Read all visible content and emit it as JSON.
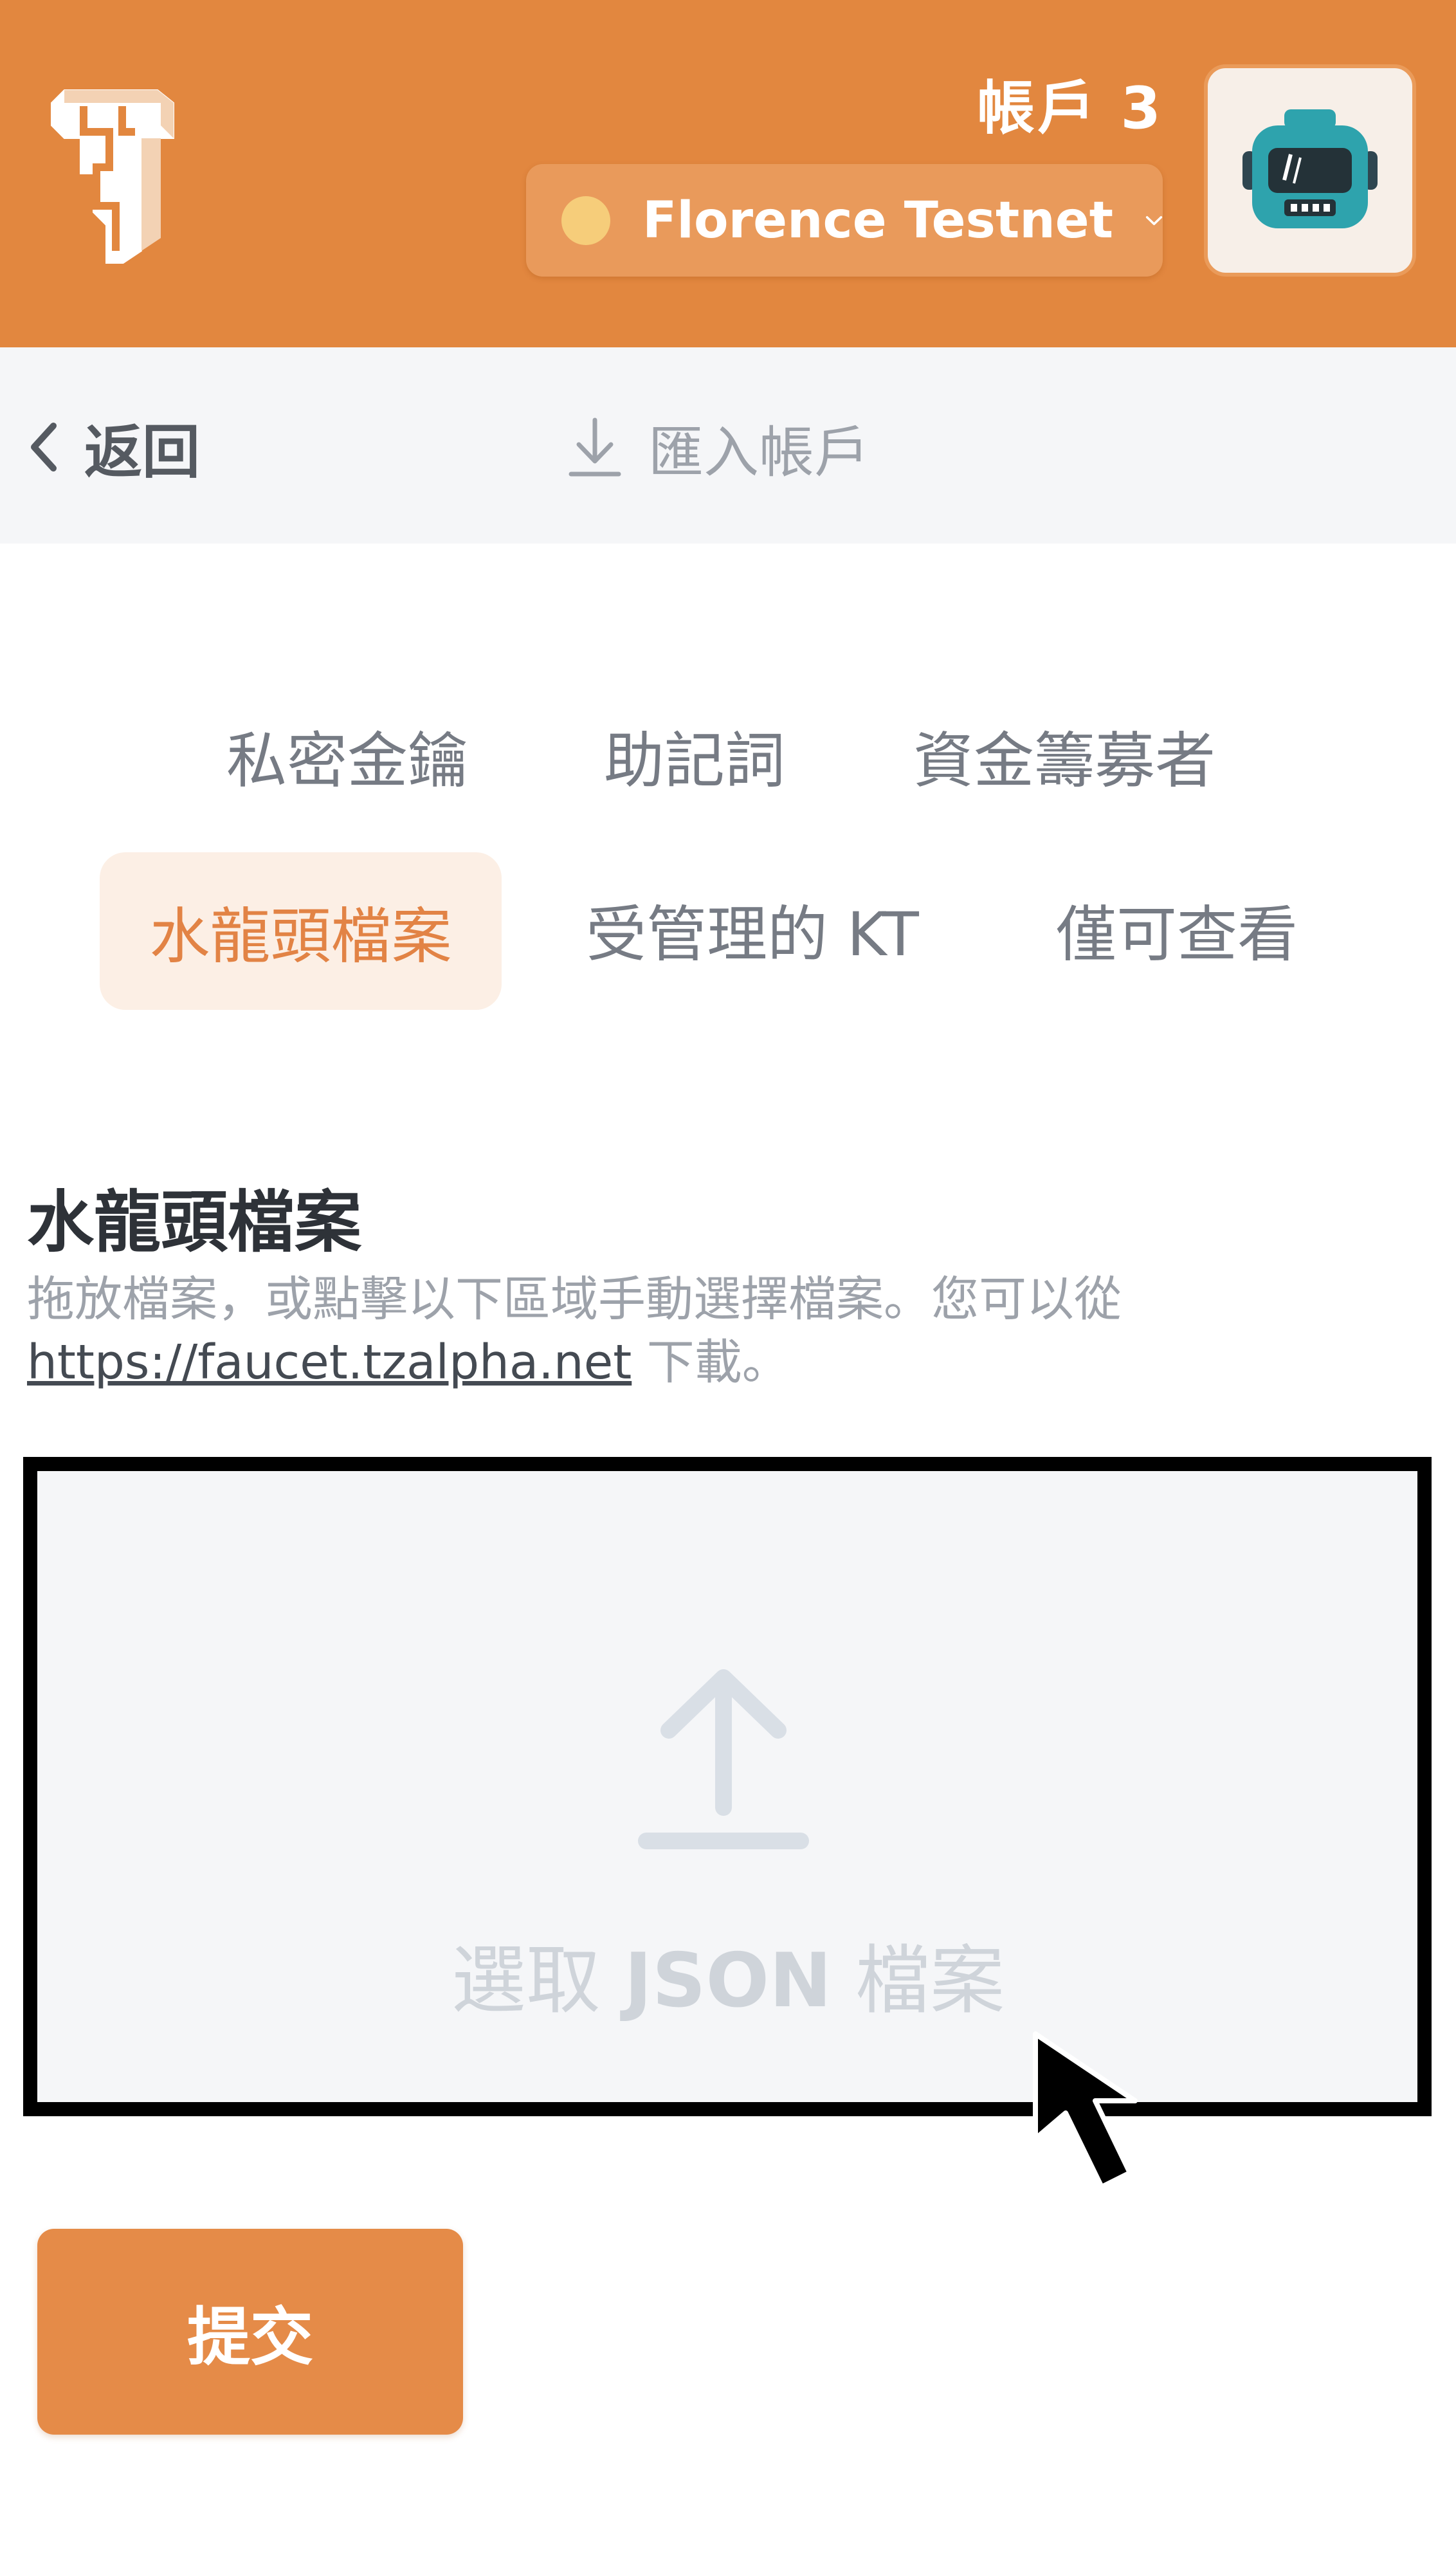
{
  "header": {
    "account_name": "帳戶 3",
    "network": {
      "label": "Florence Testnet",
      "status_color": "#f6cd7a"
    },
    "brand_color": "#e2873f",
    "logo_icon": "temple-logo-icon",
    "avatar_icon": "robot-avatar-icon"
  },
  "nav": {
    "back_label": "返回",
    "page_title": "匯入帳戶",
    "title_icon": "download-icon"
  },
  "tabs": [
    {
      "label": "私密金鑰",
      "active": false
    },
    {
      "label": "助記詞",
      "active": false
    },
    {
      "label": "資金籌募者",
      "active": false
    },
    {
      "label": "水龍頭檔案",
      "active": true
    },
    {
      "label": "受管理的 KT",
      "active": false
    },
    {
      "label": "僅可查看",
      "active": false
    }
  ],
  "section": {
    "title": "水龍頭檔案",
    "description": "拖放檔案，或點擊以下區域手動選擇檔案。您可以從",
    "link_text": "https://faucet.tzalpha.net",
    "description_suffix": " 下載。"
  },
  "dropzone": {
    "label_prefix": "選取 ",
    "label_bold": "JSON",
    "label_suffix": " 檔案",
    "icon": "upload-arrow-icon"
  },
  "submit_label": "提交",
  "accent_color": "#e58b48"
}
